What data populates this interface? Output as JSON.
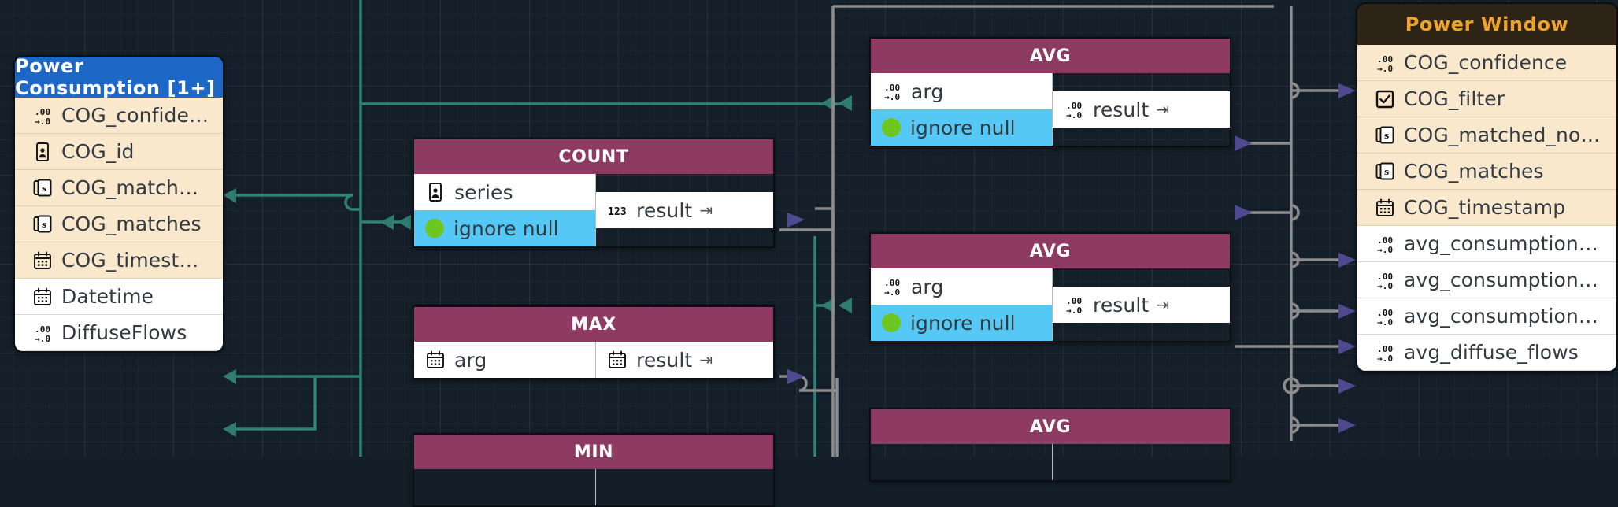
{
  "canvas": {
    "background_color": "#151f29",
    "grid_color": "#253040"
  },
  "colors": {
    "table_header_blue": "#1d68c7",
    "table_row_cream": "#fae8cd",
    "table_row_white": "#ffffff",
    "function_header_maroon": "#8e3b63",
    "port_blue": "#55c8f5",
    "port_dot_green": "#6ec71f",
    "power_window_header_bg": "#2e2416",
    "power_window_header_text": "#f0a32a",
    "wire_teal": "#2f8277",
    "wire_gray": "#8c8c8c",
    "arrow_teal": "#2f7d72",
    "arrow_purple": "#4f4a8f"
  },
  "nodes": {
    "power_consumption": {
      "title": "Power Consumption [1+]",
      "rows": [
        {
          "label": "COG_confidence",
          "icon": "float-icon",
          "style": "cream"
        },
        {
          "label": "COG_id",
          "icon": "id-card-icon",
          "style": "cream"
        },
        {
          "label": "COG_matched_nodes",
          "icon": "string-list-icon",
          "style": "cream"
        },
        {
          "label": "COG_matches",
          "icon": "string-list-icon",
          "style": "cream"
        },
        {
          "label": "COG_timestamp",
          "icon": "calendar-icon",
          "style": "cream"
        },
        {
          "label": "Datetime",
          "icon": "calendar-icon",
          "style": "white"
        },
        {
          "label": "DiffuseFlows",
          "icon": "float-icon",
          "style": "white"
        }
      ]
    },
    "power_window": {
      "title": "Power Window",
      "rows": [
        {
          "label": "COG_confidence",
          "icon": "float-icon",
          "style": "cream"
        },
        {
          "label": "COG_filter",
          "icon": "checkbox-icon",
          "style": "cream"
        },
        {
          "label": "COG_matched_nodes",
          "icon": "string-list-icon",
          "style": "cream"
        },
        {
          "label": "COG_matches",
          "icon": "string-list-icon",
          "style": "cream"
        },
        {
          "label": "COG_timestamp",
          "icon": "calendar-icon",
          "style": "cream"
        },
        {
          "label": "avg_consumption_zo...",
          "icon": "float-icon",
          "style": "white"
        },
        {
          "label": "avg_consumption_zo...",
          "icon": "float-icon",
          "style": "white"
        },
        {
          "label": "avg_consumption_zo...",
          "icon": "float-icon",
          "style": "white"
        },
        {
          "label": "avg_diffuse_flows",
          "icon": "float-icon",
          "style": "white"
        }
      ]
    },
    "count": {
      "title": "COUNT",
      "inputs": [
        {
          "label": "series",
          "icon": "id-card-icon",
          "style": "white"
        },
        {
          "label": "ignore null",
          "icon": "bool-dot-icon",
          "style": "blue"
        }
      ],
      "outputs": [
        {
          "label": "result",
          "icon": "int-icon",
          "suffix": "⇥"
        }
      ]
    },
    "max": {
      "title": "MAX",
      "inputs": [
        {
          "label": "arg",
          "icon": "calendar-icon",
          "style": "white"
        }
      ],
      "outputs": [
        {
          "label": "result",
          "icon": "calendar-icon",
          "suffix": "⇥"
        }
      ]
    },
    "min": {
      "title": "MIN",
      "inputs": [],
      "outputs": []
    },
    "avg_1": {
      "title": "AVG",
      "inputs": [
        {
          "label": "arg",
          "icon": "float-icon",
          "style": "white"
        },
        {
          "label": "ignore null",
          "icon": "bool-dot-icon",
          "style": "blue"
        }
      ],
      "outputs": [
        {
          "label": "result",
          "icon": "float-icon",
          "suffix": "⇥"
        }
      ]
    },
    "avg_2": {
      "title": "AVG",
      "inputs": [
        {
          "label": "arg",
          "icon": "float-icon",
          "style": "white"
        },
        {
          "label": "ignore null",
          "icon": "bool-dot-icon",
          "style": "blue"
        }
      ],
      "outputs": [
        {
          "label": "result",
          "icon": "float-icon",
          "suffix": "⇥"
        }
      ]
    },
    "avg_3": {
      "title": "AVG",
      "inputs": [],
      "outputs": []
    }
  }
}
